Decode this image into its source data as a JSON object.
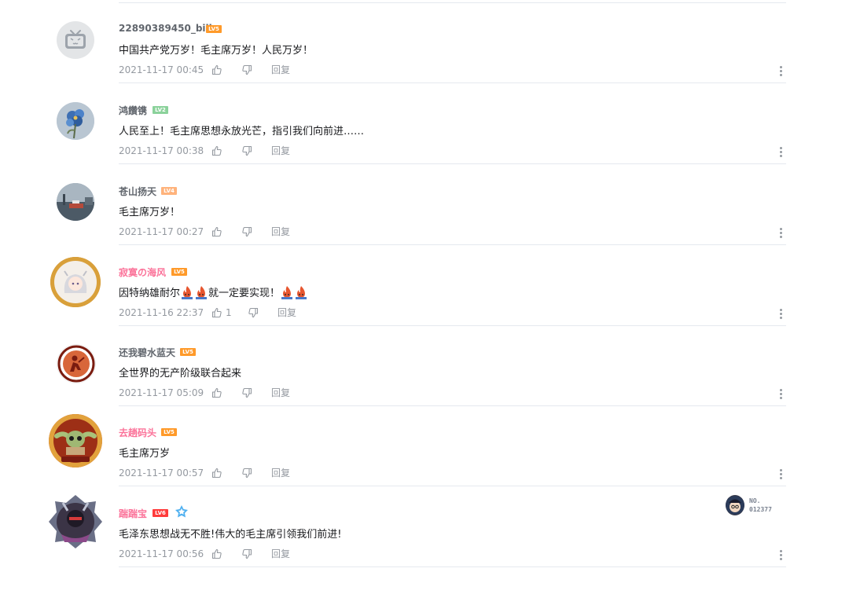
{
  "comments": [
    {
      "username": "22890389450_bili",
      "level": "LV5",
      "level_color": "#ff9a2a",
      "name_style": "normal",
      "text": "中国共产党万岁！毛主席万岁！人民万岁！",
      "time": "2021-11-17 00:45",
      "likes": "",
      "reply": "回复",
      "avatar": "tv-icon"
    },
    {
      "username": "鸿饡镌",
      "level": "LV2",
      "level_color": "#8bd29b",
      "name_style": "normal",
      "text": "人民至上！毛主席思想永放光芒，指引我们向前进……",
      "time": "2021-11-17 00:38",
      "likes": "",
      "reply": "回复",
      "avatar": "flower-icon"
    },
    {
      "username": "苍山扬天",
      "level": "LV4",
      "level_color": "#ffb37c",
      "name_style": "normal",
      "text": "毛主席万岁！",
      "time": "2021-11-17 00:27",
      "likes": "",
      "reply": "回复",
      "avatar": "harbor-icon"
    },
    {
      "username": "寂寞の海风",
      "level": "LV5",
      "level_color": "#ff9a2a",
      "name_style": "pink",
      "text_before": "因特纳雄耐尔",
      "text_middle": "就一定要实现！",
      "text": "",
      "time": "2021-11-16 22:37",
      "likes": "1",
      "reply": "回复",
      "avatar": "anime-girl-icon"
    },
    {
      "username": "还我碧水蓝天",
      "level": "LV5",
      "level_color": "#ff9a2a",
      "name_style": "normal",
      "text": "全世界的无产阶级联合起来",
      "time": "2021-11-17 05:09",
      "likes": "",
      "reply": "回复",
      "avatar": "worker-icon"
    },
    {
      "username": "去趟码头",
      "level": "LV5",
      "level_color": "#ff9a2a",
      "name_style": "pink",
      "text": "毛主席万岁",
      "time": "2021-11-17 00:57",
      "likes": "",
      "reply": "回复",
      "avatar": "baby-yoda-icon"
    },
    {
      "username": "踹踹宝",
      "level": "LV6",
      "level_color": "#ff3b3b",
      "name_style": "pink",
      "text": "毛泽东思想战无不胜!伟大的毛主席引领我们前进!",
      "time": "2021-11-17 00:56",
      "likes": "",
      "reply": "回复",
      "avatar": "knight-icon",
      "fan_badge_line1": "NO.",
      "fan_badge_line2": "012377"
    }
  ]
}
